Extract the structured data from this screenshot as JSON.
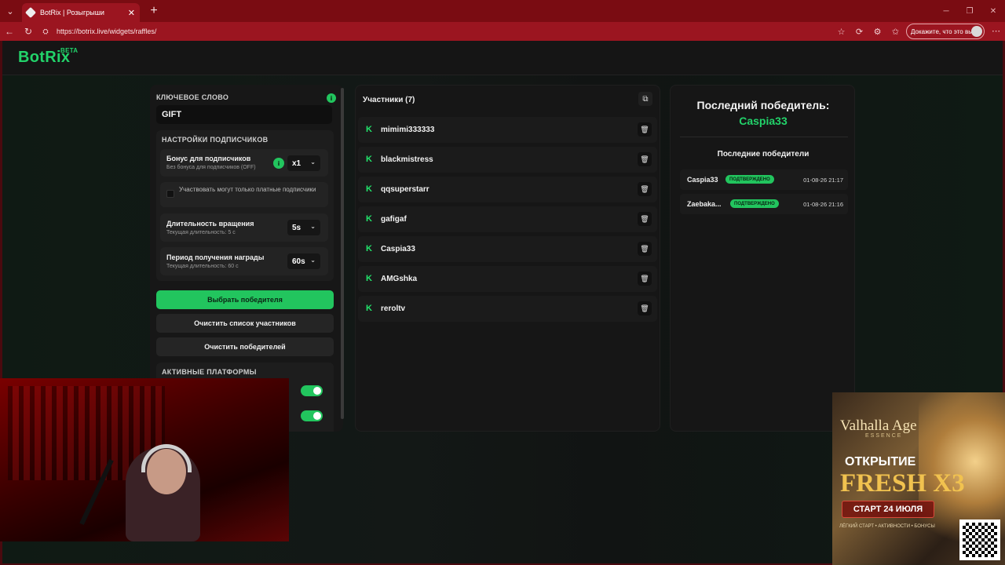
{
  "browser": {
    "tab_title": "BotRix | Розыгрыши",
    "url": "https://botrix.live/widgets/raffles/",
    "profile_text": "Докажите, что это вы"
  },
  "app": {
    "logo": "BotRix",
    "logo_badge": "BETA",
    "accent_color": "#22c55e"
  },
  "settings": {
    "keyword_label": "КЛЮЧЕВОЕ СЛОВО",
    "keyword_value": "GIFT",
    "subs_section_title": "НАСТРОЙКИ ПОДПИСЧИКОВ",
    "subs_bonus_title": "Бонус для подписчиков",
    "subs_bonus_sub": "Без бонуса для подписчиков (OFF)",
    "subs_bonus_value": "x1",
    "paid_only_label": "Участвовать могут только платные подписчики",
    "spin_title": "Длительность вращения",
    "spin_sub": "Текущая длительность: 5 с",
    "spin_value": "5s",
    "reward_title": "Период получения награды",
    "reward_sub": "Текущая длительность: 60 с",
    "reward_value": "60s",
    "pick_winner_btn": "Выбрать победителя",
    "clear_participants_btn": "Очистить список участников",
    "clear_winners_btn": "Очистить победителей",
    "platforms_title": "АКТИВНЫЕ ПЛАТФОРМЫ"
  },
  "participants": {
    "title": "Участники (7)",
    "items": [
      {
        "name": "mimimi333333"
      },
      {
        "name": "blackmistress"
      },
      {
        "name": "qqsuperstarr"
      },
      {
        "name": "gafigaf"
      },
      {
        "name": "Caspia33"
      },
      {
        "name": "AMGshka"
      },
      {
        "name": "reroltv"
      }
    ]
  },
  "winners": {
    "last_title": "Последний победитель:",
    "last_name": "Caspia33",
    "recent_title": "Последние победители",
    "items": [
      {
        "name": "Caspia33",
        "badge": "ПОДТВЕРЖДЕНО",
        "date": "01-08-26 21:17"
      },
      {
        "name": "Zaebaka...",
        "badge": "ПОДТВЕРЖДЕНО",
        "date": "01-08-26 21:16"
      }
    ]
  },
  "ad": {
    "brand": "Valhalla Age",
    "brand_sub": "ESSENCE",
    "line1": "ОТКРЫТИЕ",
    "line2": "FRESH X3",
    "line3": "СТАРТ 24 ИЮЛЯ",
    "tagline": "ЛЁГКИЙ СТАРТ • АКТИВНОСТИ • БОНУСЫ"
  }
}
